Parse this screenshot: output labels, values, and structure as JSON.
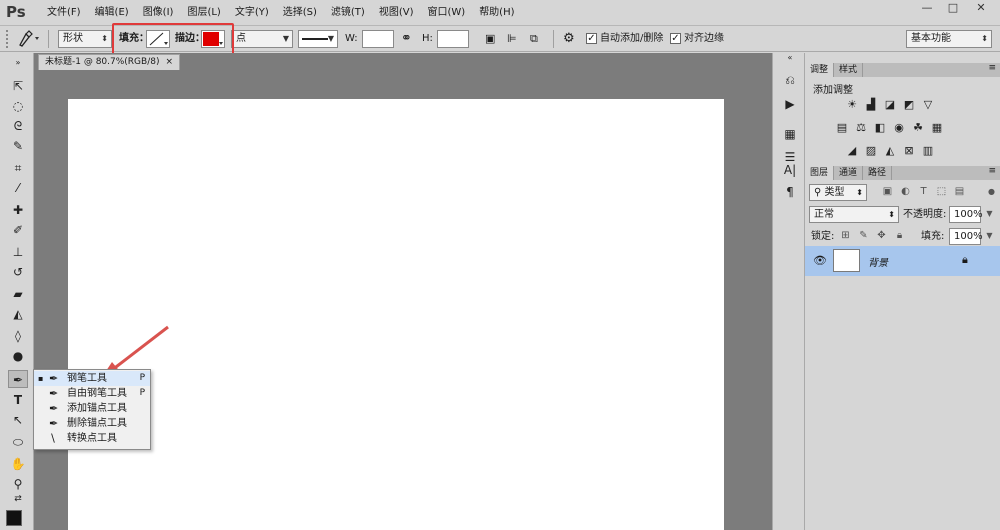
{
  "menubar": {
    "logo": "Ps",
    "items": [
      "文件(F)",
      "编辑(E)",
      "图像(I)",
      "图层(L)",
      "文字(Y)",
      "选择(S)",
      "滤镜(T)",
      "视图(V)",
      "窗口(W)",
      "帮助(H)"
    ],
    "window_controls": {
      "minimize": "—",
      "maximize": "□",
      "close": "✕"
    }
  },
  "options": {
    "tool_preset_icon": "pen-icon",
    "mode": "形状",
    "fill_label": "填充：",
    "stroke_label": "描边：",
    "stroke_color": "#e00000",
    "stroke_width": "点",
    "w_label": "W:",
    "w_value": "",
    "h_label": "H:",
    "h_value": "",
    "auto_add_delete": "自动添加/删除",
    "auto_add_delete_checked": true,
    "align_edges": "对齐边缘",
    "align_edges_checked": true,
    "workspace": "基本功能",
    "highlight_color": "#e03a3a"
  },
  "document": {
    "tab_title": "未标题-1 @ 80.7%(RGB/8)",
    "tab_close": "×"
  },
  "flyout": {
    "items": [
      {
        "label": "钢笔工具",
        "key": "P",
        "icon": "pen-icon",
        "selected": true
      },
      {
        "label": "自由钢笔工具",
        "key": "P",
        "icon": "freeform-pen-icon",
        "selected": false
      },
      {
        "label": "添加锚点工具",
        "key": "",
        "icon": "add-anchor-icon",
        "selected": false
      },
      {
        "label": "删除锚点工具",
        "key": "",
        "icon": "delete-anchor-icon",
        "selected": false
      },
      {
        "label": "转换点工具",
        "key": "",
        "icon": "convert-point-icon",
        "selected": false
      }
    ],
    "selected_mark": "▪"
  },
  "adjustments": {
    "tabs": [
      "调整",
      "样式"
    ],
    "title": "添加调整"
  },
  "layers": {
    "tabs": [
      "图层",
      "通道",
      "路径"
    ],
    "filter_kind": "类型",
    "blend_mode": "正常",
    "opacity_label": "不透明度:",
    "opacity": "100%",
    "lock_label": "锁定:",
    "fill_label": "填充:",
    "fill": "100%",
    "layer_name": "背景"
  }
}
